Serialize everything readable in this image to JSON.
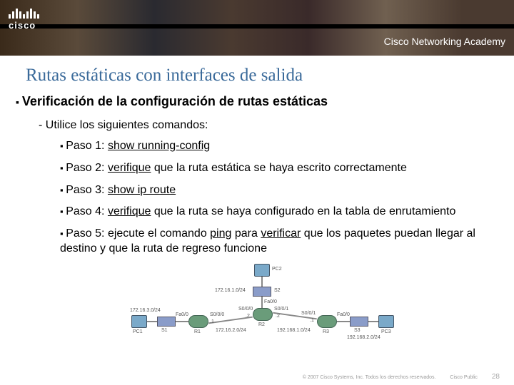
{
  "header": {
    "brand": "cisco",
    "academy": "Cisco Networking Academy"
  },
  "slide": {
    "title": "Rutas estáticas con interfaces de salida",
    "subtitle": "Verificación de la configuración de rutas estáticas",
    "intro": "- Utilice los siguientes comandos:",
    "steps": [
      {
        "label": "Paso 1:",
        "cmd": "show running-config",
        "rest": ""
      },
      {
        "label": "Paso 2:",
        "cmd": "verifique",
        "rest": " que la ruta estática se haya escrito correctamente"
      },
      {
        "label": "Paso 3:",
        "cmd": "show ip route",
        "rest": ""
      },
      {
        "label": "Paso 4:",
        "cmd": "verifique",
        "rest": " que la ruta se haya configurado en la tabla de enrutamiento"
      },
      {
        "label": "Paso 5:",
        "pre": "ejecute el comando ",
        "cmd": "ping",
        "mid": " para ",
        "cmd2": "verificar",
        "rest": " que los paquetes puedan llegar al destino y que la ruta de regreso funcione"
      }
    ]
  },
  "diagram": {
    "nodes": {
      "pc1": "PC1",
      "pc2": "PC2",
      "pc3": "PC3",
      "r1": "R1",
      "r2": "R2",
      "r3": "R3",
      "s1": "S1",
      "s2": "S2",
      "s3": "S3"
    },
    "nets": {
      "n1": "172.16.3.0/24",
      "nS2": "172.16.1.0/24",
      "link12": "172.16.2.0/24",
      "link23": "192.168.1.0/24",
      "nS3": "192.168.2.0/24"
    },
    "ifs": {
      "fa0": "Fa0/0",
      "s000": "S0/0/0",
      "s001": "S0/0/1",
      "dot1": ".1",
      "dot2": ".2"
    }
  },
  "footer": {
    "copyright": "© 2007 Cisco Systems, Inc. Todos los derechos reservados.",
    "public": "Cisco Public",
    "page": "28"
  }
}
